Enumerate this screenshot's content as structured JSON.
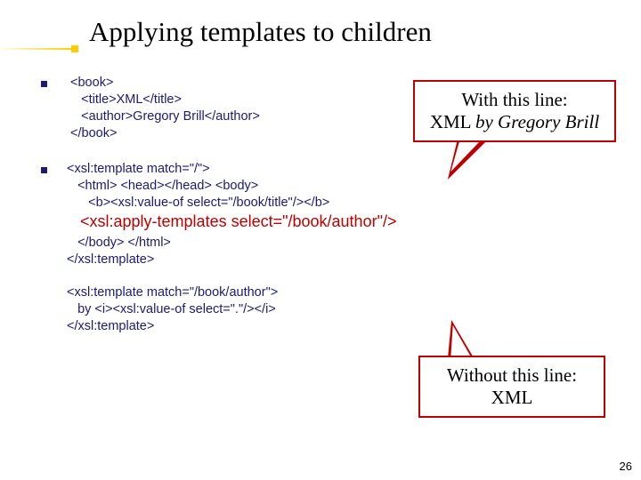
{
  "title": "Applying templates to children",
  "blocks": {
    "book_code": " <book>\n    <title>XML</title>\n    <author>Gregory Brill</author>\n </book>",
    "template_top": "<xsl:template match=\"/\">\n   <html> <head></head> <body>\n      <b><xsl:value-of select=\"/book/title\"/></b>",
    "apply_line": "   <xsl:apply-templates select=\"/book/author\"/>",
    "template_close": "   </body> </html>\n</xsl:template>",
    "author_template": "<xsl:template match=\"/book/author\">\n   by <i><xsl:value-of select=\".\"/></i>\n</xsl:template>"
  },
  "callouts": {
    "with_line1": "With this line:",
    "with_line2a": "XML ",
    "with_line2b": "by Gregory Brill",
    "without_line1": "Without this line:",
    "without_line2": "XML"
  },
  "page_number": "26"
}
